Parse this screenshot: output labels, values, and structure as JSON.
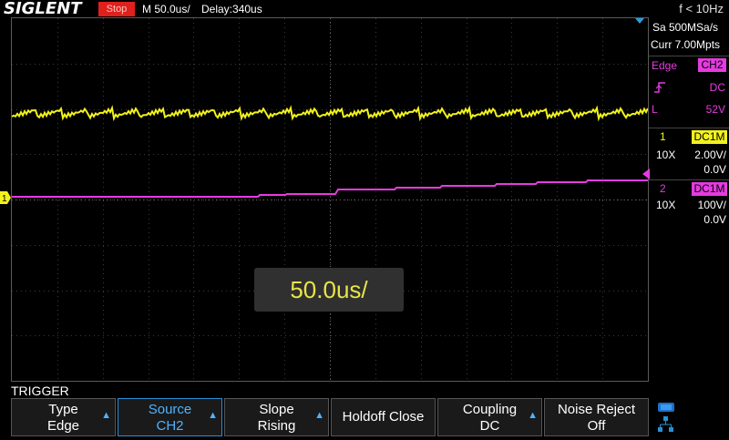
{
  "topbar": {
    "brand": "SIGLENT",
    "status": "Stop",
    "timebase": "M 50.0us/",
    "delay": "Delay:340us",
    "frequency": "f < 10Hz"
  },
  "acquisition": {
    "sample_rate": "Sa 500MSa/s",
    "memory_depth": "Curr 7.00Mpts"
  },
  "trigger_info": {
    "mode_label": "Edge",
    "source": "CH2",
    "coupling": "DC",
    "level_label": "L",
    "level": "52V",
    "slope_icon": "rising-edge-icon"
  },
  "channels": [
    {
      "number": "1",
      "coupling": "DC1M",
      "probe": "10X",
      "scale": "2.00V/",
      "offset": "0.0V",
      "color": "#f2f21c"
    },
    {
      "number": "2",
      "coupling": "DC1M",
      "probe": "10X",
      "scale": "100V/",
      "offset": "0.0V",
      "color": "#e53be0"
    }
  ],
  "popup": {
    "text": "50.0us/"
  },
  "trigger_menu": {
    "title": "TRIGGER",
    "buttons": [
      {
        "label": "Type",
        "value": "Edge"
      },
      {
        "label": "Source",
        "value": "CH2"
      },
      {
        "label": "Slope",
        "value": "Rising"
      },
      {
        "label": "Holdoff Close",
        "value": ""
      },
      {
        "label": "Coupling",
        "value": "DC"
      },
      {
        "label": "Noise Reject",
        "value": "Off"
      }
    ]
  },
  "colors": {
    "ch1": "#f2f21c",
    "ch2": "#e53be0",
    "accent": "#2a8fd8",
    "stop": "#e0201c"
  }
}
